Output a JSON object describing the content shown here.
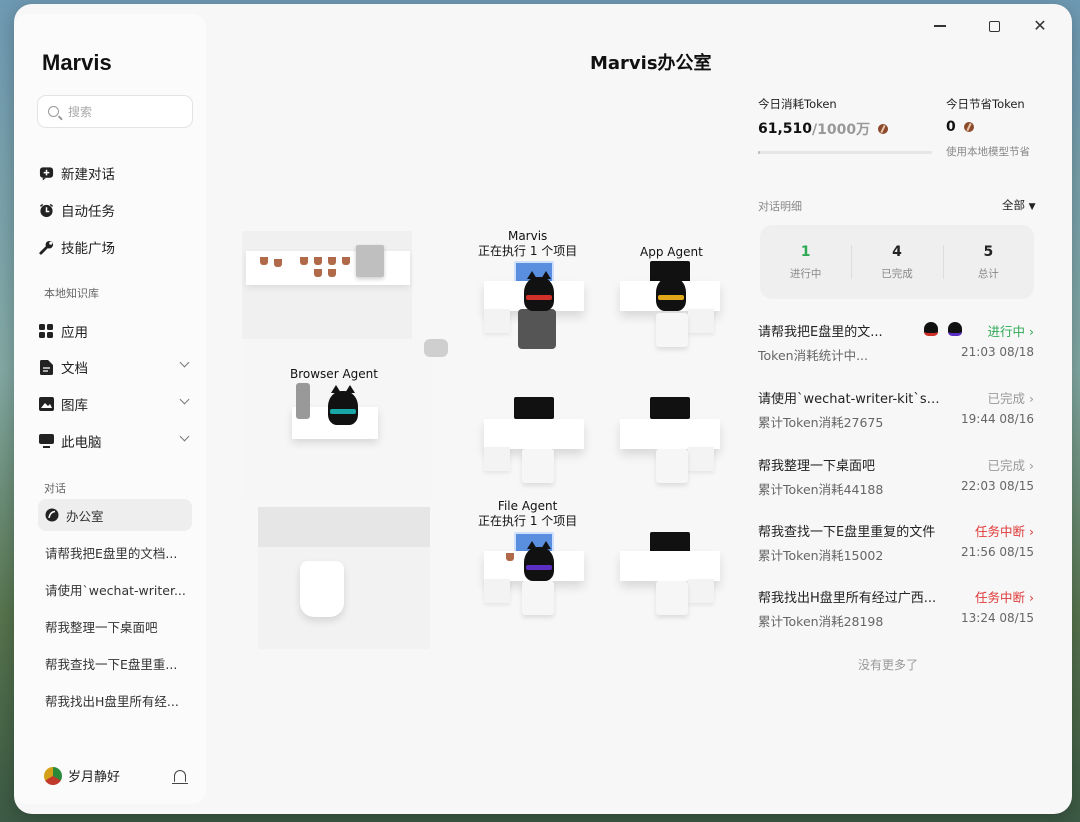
{
  "window": {
    "controls": {
      "minimize": "minimize",
      "maximize": "maximize",
      "close": "close"
    }
  },
  "sidebar": {
    "brand": "Marvis",
    "search_placeholder": "搜索",
    "top_items": [
      {
        "label": "新建对话",
        "icon": "new-chat-icon"
      },
      {
        "label": "自动任务",
        "icon": "clock-icon"
      },
      {
        "label": "技能广场",
        "icon": "wrench-icon"
      }
    ],
    "kb_label": "本地知识库",
    "kb_items": [
      {
        "label": "应用",
        "icon": "apps-icon"
      },
      {
        "label": "文档",
        "icon": "document-icon"
      },
      {
        "label": "图库",
        "icon": "image-icon"
      },
      {
        "label": "此电脑",
        "icon": "computer-icon"
      }
    ],
    "chats_label": "对话",
    "chats": [
      {
        "label": "办公室",
        "active": true
      },
      {
        "label": "请帮我把E盘里的文档..."
      },
      {
        "label": "请使用`wechat-writer..."
      },
      {
        "label": "帮我整理一下桌面吧"
      },
      {
        "label": "帮我查找一下E盘里重..."
      },
      {
        "label": "帮我找出H盘里所有经..."
      }
    ],
    "user": "岁月静好"
  },
  "main": {
    "title": "Marvis办公室",
    "agents": {
      "marvis": {
        "name": "Marvis",
        "status": "正在执行 1 个项目"
      },
      "app": {
        "name": "App Agent"
      },
      "browser": {
        "name": "Browser Agent"
      },
      "file": {
        "name": "File Agent",
        "status": "正在执行 1 个项目"
      }
    }
  },
  "stats": {
    "today_used_label": "今日消耗Token",
    "today_used": "61,510",
    "today_limit": "/1000万",
    "today_used_fraction": 0.006,
    "today_saved_label": "今日节省Token",
    "today_saved": "0",
    "saved_note": "使用本地模型节省"
  },
  "details": {
    "title": "对话明细",
    "filter": "全部",
    "summary": [
      {
        "num": "1",
        "label": "进行中"
      },
      {
        "num": "4",
        "label": "已完成"
      },
      {
        "num": "5",
        "label": "总计"
      }
    ],
    "tasks": [
      {
        "title": "请帮我把E盘里的文...",
        "status": "进行中",
        "status_type": "run",
        "sub": "Token消耗统计中...",
        "time": "21:03 08/18"
      },
      {
        "title": "请使用`wechat-writer-kit`ski...",
        "status": "已完成",
        "status_type": "done",
        "sub": "累计Token消耗27675",
        "time": "19:44 08/16"
      },
      {
        "title": "帮我整理一下桌面吧",
        "status": "已完成",
        "status_type": "done",
        "sub": "累计Token消耗44188",
        "time": "22:03 08/15"
      },
      {
        "title": "帮我查找一下E盘里重复的文件",
        "status": "任务中断",
        "status_type": "err",
        "sub": "累计Token消耗15002",
        "time": "21:56 08/15"
      },
      {
        "title": "帮我找出H盘里所有经过广西...",
        "status": "任务中断",
        "status_type": "err",
        "sub": "累计Token消耗28198",
        "time": "13:24 08/15"
      }
    ],
    "no_more": "没有更多了"
  },
  "colors": {
    "green": "#2eaa55",
    "red": "#e03a3a",
    "gray": "#999999"
  }
}
